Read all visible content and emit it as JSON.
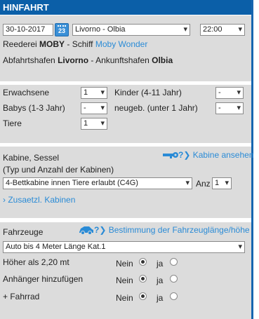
{
  "header": {
    "title": "HINFAHRT"
  },
  "trip": {
    "date": "30-10-2017",
    "calendar_day": "23",
    "route": "Livorno - Olbia",
    "time": "22:00",
    "shipping_label": "Reederei",
    "shipping_company": "MOBY",
    "ship_separator": "- Schiff",
    "ship_name": "Moby Wonder",
    "departure_label": "Abfahrtshafen",
    "departure_port": "Livorno",
    "arrival_label": "- Ankunftshafen",
    "arrival_port": "Olbia"
  },
  "passengers": {
    "adults_label": "Erwachsene",
    "adults_value": "1",
    "children_label": "Kinder (4-11 Jahr)",
    "children_value": "-",
    "babies_label": "Babys (1-3 Jahr)",
    "babies_value": "-",
    "newborn_label": "neugeb. (unter 1 Jahr)",
    "newborn_value": "-",
    "pets_label": "Tiere",
    "pets_value": "1"
  },
  "cabins": {
    "title": "Kabine, Sessel",
    "subtitle": "(Typ und Anzahl der Kabinen)",
    "help_icon_text": "?",
    "view_link": "Kabine ansehen",
    "cabin_type": "4-Bettkabine innen Tiere erlaubt (C4G)",
    "qty_label": "Anz",
    "qty_value": "1",
    "extra_link": "› Zusaetzl. Kabinen"
  },
  "vehicles": {
    "title": "Fahrzeuge",
    "help_icon_text": "?",
    "size_link": "Bestimmung der Fahrzeuglänge/höhe",
    "vehicle_type": "Auto bis 4 Meter Länge Kat.1",
    "options": [
      {
        "label": "Höher als 2,20 mt",
        "no": "Nein",
        "yes": "ja",
        "selected": "no"
      },
      {
        "label": "Anhänger hinzufügen",
        "no": "Nein",
        "yes": "ja",
        "selected": "no"
      },
      {
        "label": "+ Fahrrad",
        "no": "Nein",
        "yes": "ja",
        "selected": "no"
      }
    ]
  },
  "colors": {
    "accent": "#0b5fa8",
    "link": "#2a8bd6",
    "panel": "#dcdcdc"
  },
  "icons": [
    "calendar-icon",
    "key-icon",
    "car-icon",
    "help-icon",
    "chevron-down-icon"
  ]
}
